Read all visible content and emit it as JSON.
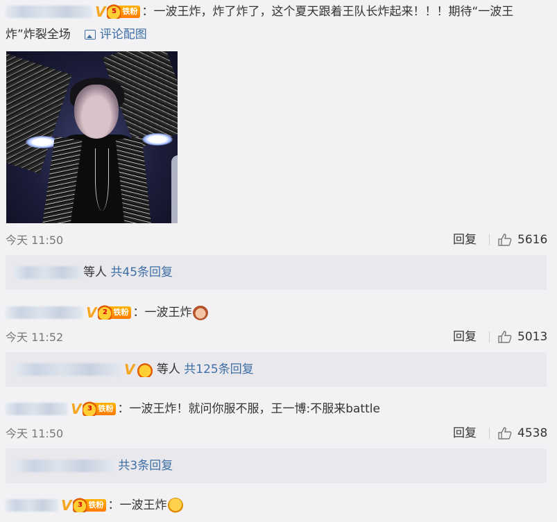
{
  "comments": [
    {
      "badge_text": "铁粉",
      "text": "：一波王炸，炸了炸了，这个夏天跟着王队长炸起来！！！期待“一波王",
      "text_cont": "炸”炸裂全场",
      "pic_link": "评论配图",
      "time": "今天 11:50",
      "reply_label": "回复",
      "likes": "5616",
      "replies_suffix": "等人",
      "replies_count": "共45条回复"
    },
    {
      "badge_text": "铁粉",
      "text": "：一波王炸",
      "time": "今天 11:52",
      "reply_label": "回复",
      "likes": "5013",
      "replies_suffix": "等人",
      "replies_count": "共125条回复"
    },
    {
      "badge_text": "铁粉",
      "text": "：一波王炸！就问你服不服，王一博:不服来battle",
      "time": "今天 11:50",
      "reply_label": "回复",
      "likes": "4538",
      "replies_count": "共3条回复"
    },
    {
      "badge_text": "铁粉",
      "text": "：一波王炸"
    }
  ],
  "colors": {
    "link": "#3d6fa6",
    "vip": "#f5a623",
    "badge": "#ff8c00"
  },
  "icons": {
    "like": "thumbs-up-icon",
    "image": "image-icon",
    "verified": "verified-v-icon",
    "fan": "crown-badge-icon"
  }
}
